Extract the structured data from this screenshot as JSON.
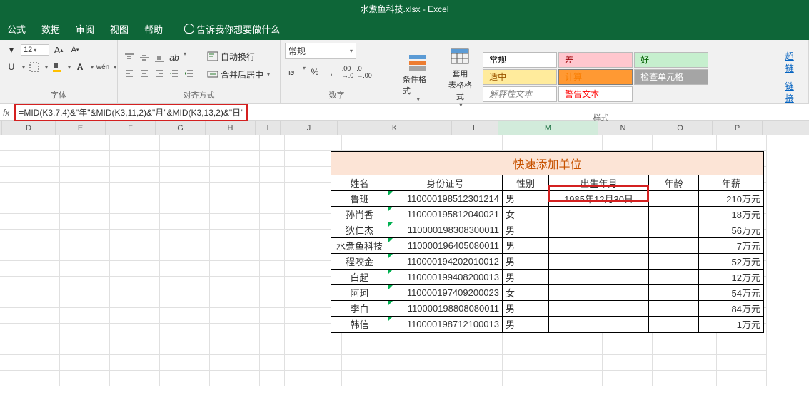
{
  "app": {
    "title": "水煮鱼科技.xlsx  -  Excel"
  },
  "menu": {
    "formula": "公式",
    "data": "数据",
    "review": "审阅",
    "view": "视图",
    "help": "帮助",
    "tellme": "告诉我你想要做什么"
  },
  "ribbon": {
    "font_group": "字体",
    "align_group": "对齐方式",
    "number_group": "数字",
    "styles_group": "样式",
    "font_size": "12",
    "wrap_text": "自动换行",
    "merge_center": "合并后居中",
    "number_format": "常规",
    "cond_format": "条件格式",
    "format_table": "套用\n表格格式",
    "style_normal": "常规",
    "style_bad": "差",
    "style_good": "好",
    "style_neutral": "适中",
    "style_calc": "计算",
    "style_check": "检查单元格",
    "style_explain": "解释性文本",
    "style_warn": "警告文本",
    "hyperlink": "超链",
    "link2": "链接"
  },
  "formula_bar": {
    "formula": "=MID(K3,7,4)&\"年\"&MID(K3,11,2)&\"月\"&MID(K3,13,2)&\"日\""
  },
  "columns": [
    "D",
    "E",
    "F",
    "G",
    "H",
    "I",
    "J",
    "K",
    "L",
    "M",
    "N",
    "O",
    "P"
  ],
  "table": {
    "title": "快速添加单位",
    "headers": {
      "name": "姓名",
      "id": "身份证号",
      "sex": "性别",
      "dob": "出生年月",
      "age": "年龄",
      "salary": "年薪"
    },
    "rows": [
      {
        "name": "鲁班",
        "id": "110000198512301214",
        "sex": "男",
        "dob": "1985年12月30日",
        "age": "",
        "salary": "210万元"
      },
      {
        "name": "孙尚香",
        "id": "110000195812040021",
        "sex": "女",
        "dob": "",
        "age": "",
        "salary": "18万元"
      },
      {
        "name": "狄仁杰",
        "id": "110000198308300011",
        "sex": "男",
        "dob": "",
        "age": "",
        "salary": "56万元"
      },
      {
        "name": "水煮鱼科技",
        "id": "110000196405080011",
        "sex": "男",
        "dob": "",
        "age": "",
        "salary": "7万元"
      },
      {
        "name": "程咬金",
        "id": "110000194202010012",
        "sex": "男",
        "dob": "",
        "age": "",
        "salary": "52万元"
      },
      {
        "name": "白起",
        "id": "110000199408200013",
        "sex": "男",
        "dob": "",
        "age": "",
        "salary": "12万元"
      },
      {
        "name": "阿珂",
        "id": "110000197409200023",
        "sex": "女",
        "dob": "",
        "age": "",
        "salary": "54万元"
      },
      {
        "name": "李白",
        "id": "110000198808080011",
        "sex": "男",
        "dob": "",
        "age": "",
        "salary": "84万元"
      },
      {
        "name": "韩信",
        "id": "110000198712100013",
        "sex": "男",
        "dob": "",
        "age": "",
        "salary": "1万元"
      }
    ]
  }
}
